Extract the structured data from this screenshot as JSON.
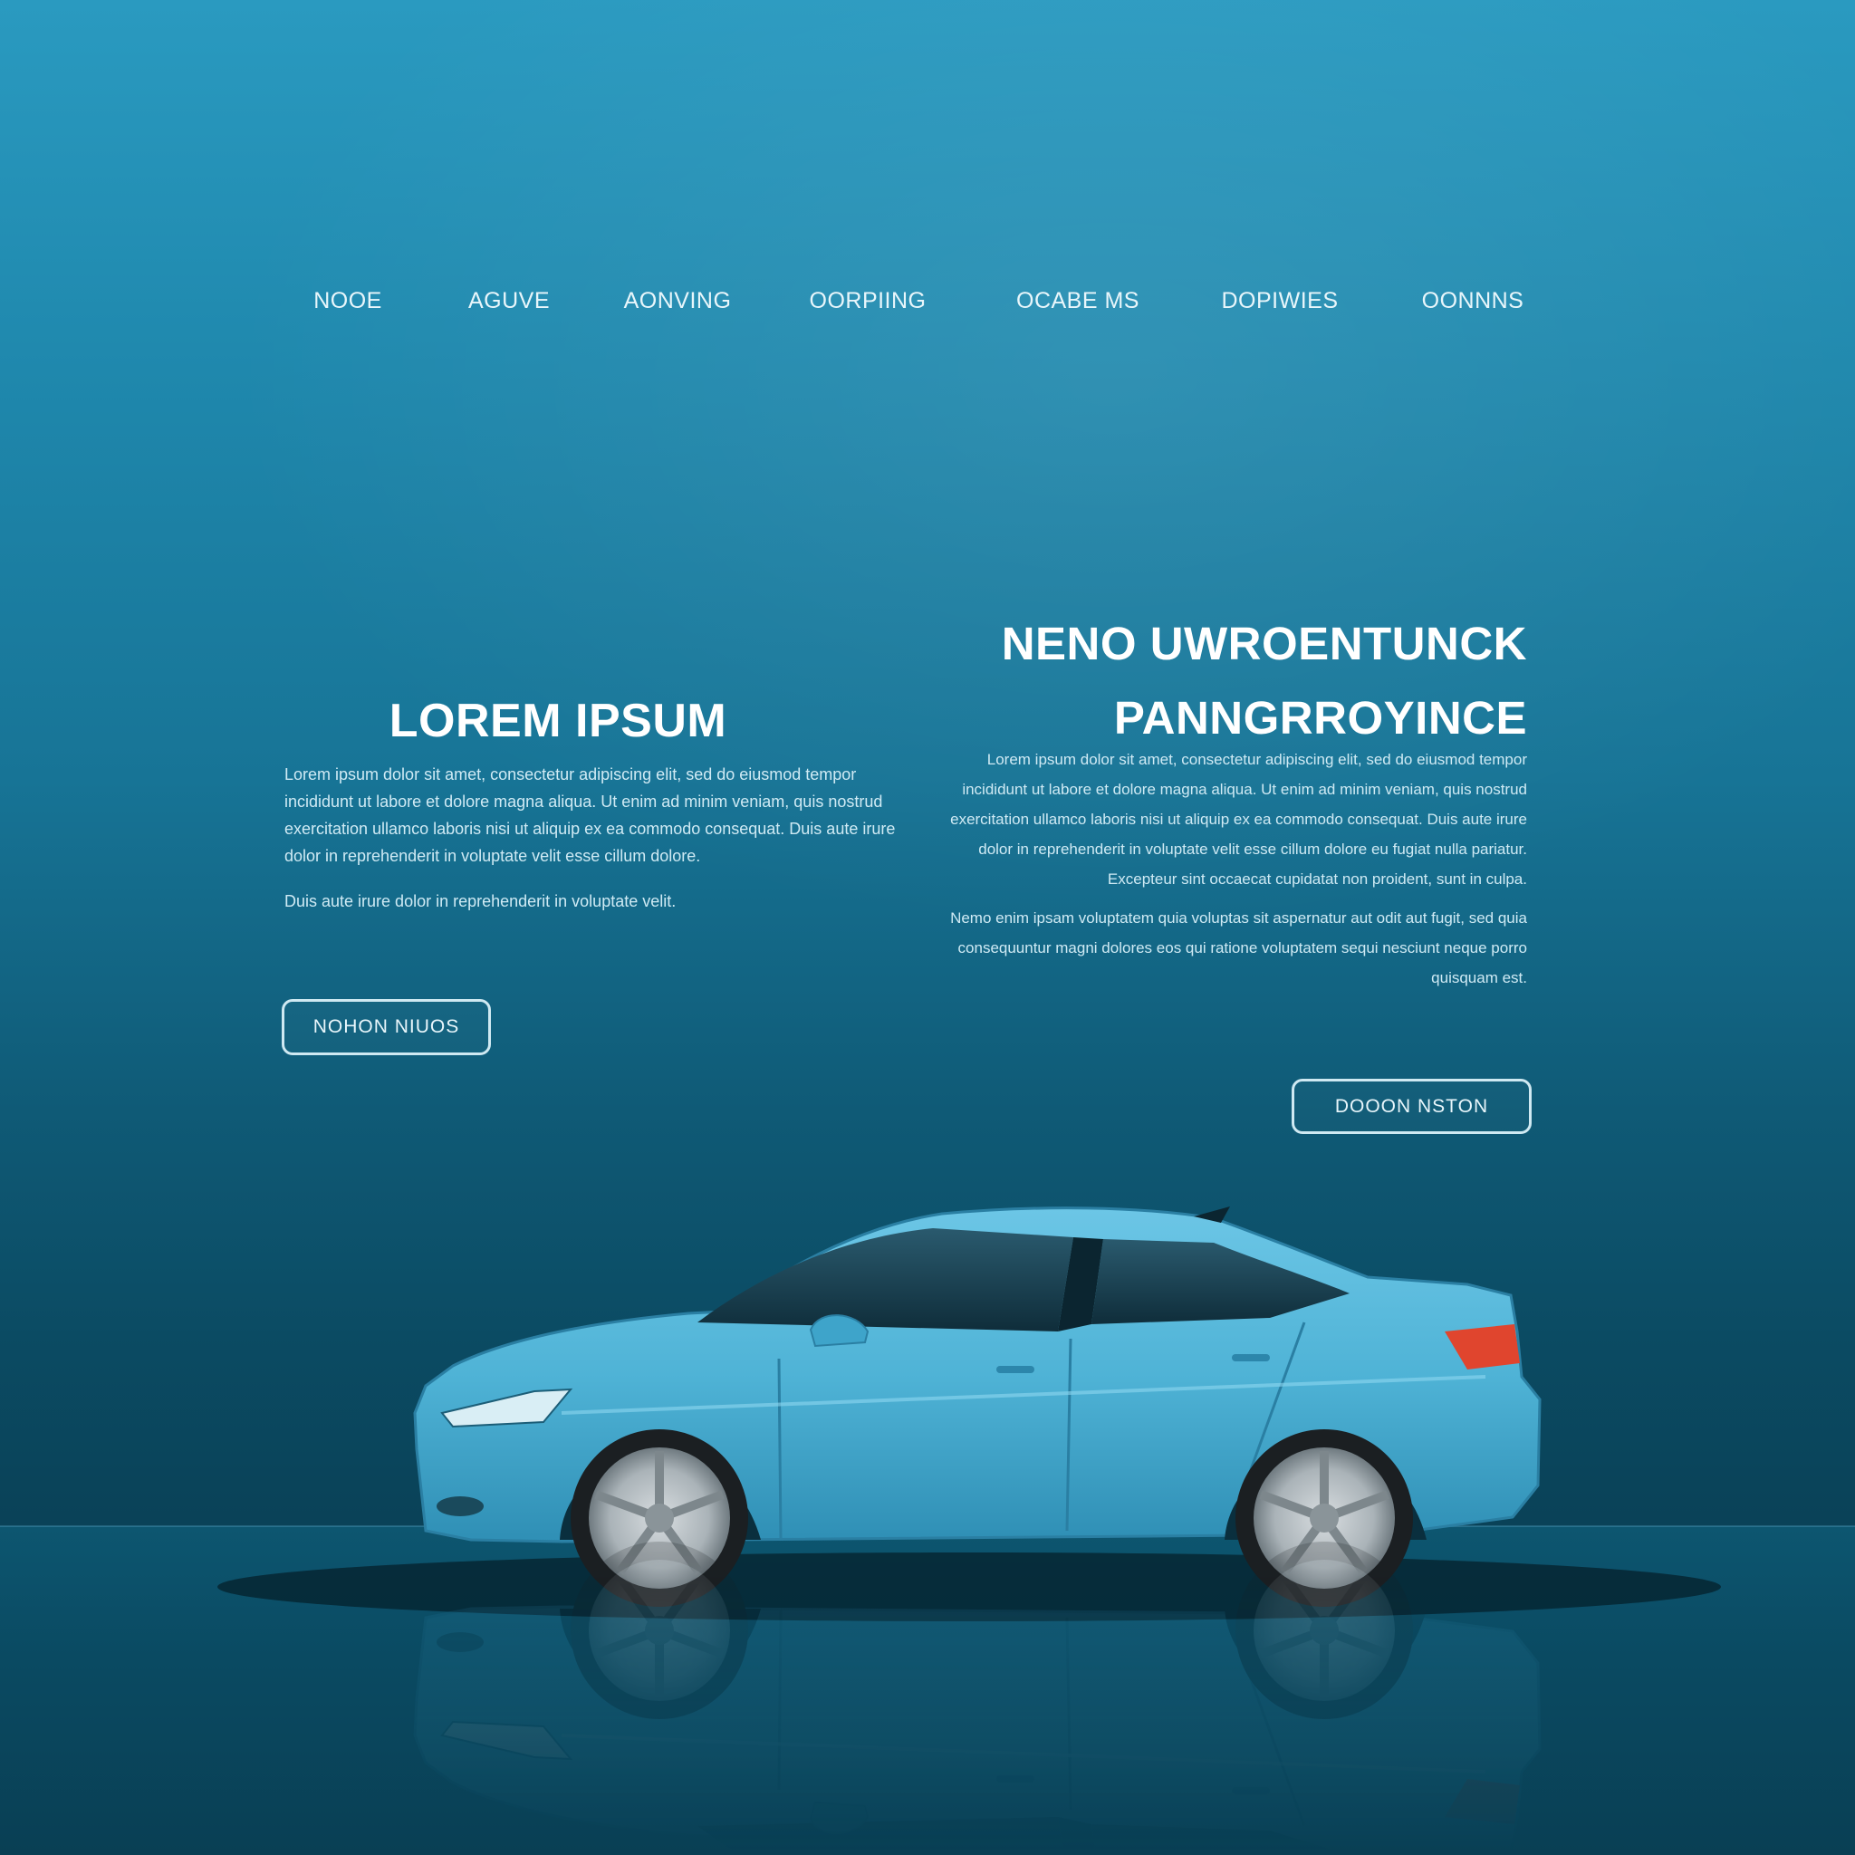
{
  "nav": {
    "items": [
      "NOOE",
      "AGUVE",
      "AONVING",
      "OORPIING",
      "OCABE MS",
      "DOPIWIES",
      "OONNNS"
    ]
  },
  "hero_left": {
    "title": "LOREM IPSUM",
    "paragraphs": [
      "Lorem ipsum dolor sit amet, consectetur adipiscing elit, sed do eiusmod tempor incididunt ut labore et dolore magna aliqua. Ut enim ad minim veniam, quis nostrud exercitation ullamco laboris nisi ut aliquip ex ea commodo consequat. Duis aute irure dolor in reprehenderit in voluptate velit esse cillum dolore.",
      "Duis aute irure dolor in reprehenderit in voluptate velit."
    ],
    "button_label": "NOHON NIUOS"
  },
  "hero_right": {
    "title_line1": "NENO UWROENTUNCK",
    "title_line2": "PANNGRROYINCE",
    "paragraphs": [
      "Lorem ipsum dolor sit amet, consectetur adipiscing elit, sed do eiusmod tempor incididunt ut labore et dolore magna aliqua. Ut enim ad minim veniam, quis nostrud exercitation ullamco laboris nisi ut aliquip ex ea commodo consequat. Duis aute irure dolor in reprehenderit in voluptate velit esse cillum dolore eu fugiat nulla pariatur. Excepteur sint occaecat cupidatat non proident, sunt in culpa.",
      "Nemo enim ipsam voluptatem quia voluptas sit aspernatur aut odit aut fugit, sed quia consequuntur magni dolores eos qui ratione voluptatem sequi nesciunt neque porro quisquam est."
    ],
    "button_label": "DOOON NSTON"
  },
  "colors": {
    "background_top": "#2a9ac0",
    "background_bottom": "#083a4e",
    "car_body": "#4fb3d6",
    "text": "#eaf7fc"
  }
}
